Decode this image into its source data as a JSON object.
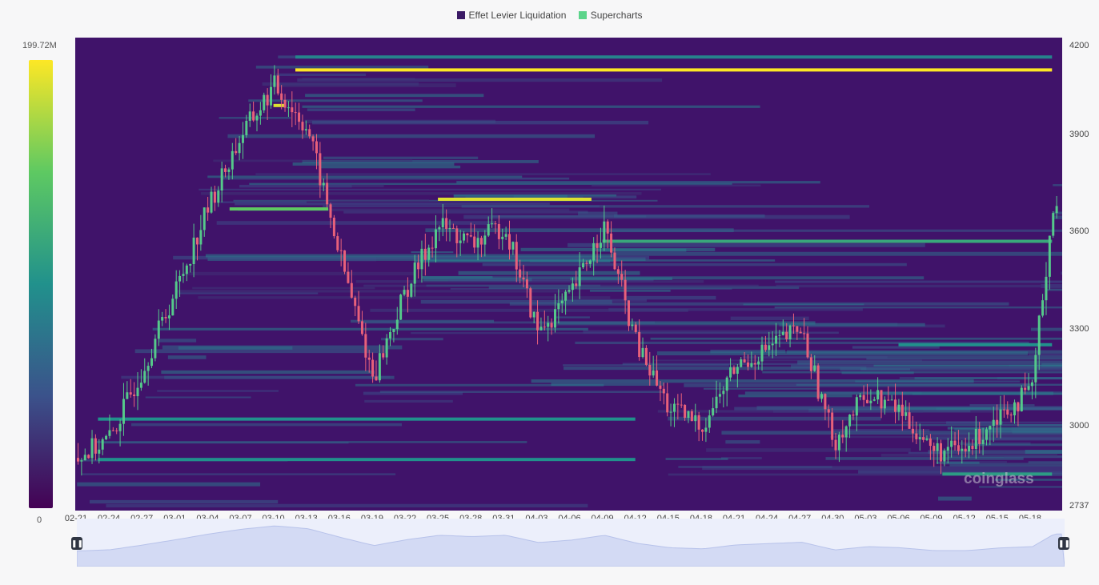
{
  "legend": {
    "items": [
      {
        "label": "Effet Levier Liquidation",
        "color": "#3b1a66"
      },
      {
        "label": "Supercharts",
        "color": "#5bd48a"
      }
    ]
  },
  "colorscale": {
    "max_label": "199.72M",
    "min_label": "0",
    "colors": [
      "#440154",
      "#3b528b",
      "#21918c",
      "#5ec962",
      "#fde725"
    ]
  },
  "watermark": "coinglass",
  "colors": {
    "up": "#55c98a",
    "down": "#e8607a",
    "background": "#40136a"
  },
  "chart_data": {
    "type": "heatmap",
    "title": "",
    "xlabel": "",
    "ylabel": "",
    "ylim": [
      2737,
      4200
    ],
    "y_ticks": [
      "4200",
      "3900",
      "3600",
      "3300",
      "3000",
      "2737"
    ],
    "x_ticks": [
      "02-21",
      "02-24",
      "02-27",
      "03-01",
      "03-04",
      "03-07",
      "03-10",
      "03-13",
      "03-16",
      "03-19",
      "03-22",
      "03-25",
      "03-28",
      "03-31",
      "04-03",
      "04-06",
      "04-09",
      "04-12",
      "04-15",
      "04-18",
      "04-21",
      "04-24",
      "04-27",
      "04-30",
      "05-03",
      "05-06",
      "05-09",
      "05-12",
      "05-15",
      "05-18"
    ],
    "price_path": [
      {
        "x": "02-21",
        "y": 2900
      },
      {
        "x": "02-24",
        "y": 2960
      },
      {
        "x": "02-27",
        "y": 3180
      },
      {
        "x": "03-01",
        "y": 3420
      },
      {
        "x": "03-04",
        "y": 3680
      },
      {
        "x": "03-07",
        "y": 3900
      },
      {
        "x": "03-10",
        "y": 4050
      },
      {
        "x": "03-13",
        "y": 3920
      },
      {
        "x": "03-16",
        "y": 3520
      },
      {
        "x": "03-19",
        "y": 3150
      },
      {
        "x": "03-22",
        "y": 3420
      },
      {
        "x": "03-25",
        "y": 3620
      },
      {
        "x": "03-28",
        "y": 3560
      },
      {
        "x": "03-31",
        "y": 3620
      },
      {
        "x": "04-03",
        "y": 3290
      },
      {
        "x": "04-06",
        "y": 3400
      },
      {
        "x": "04-09",
        "y": 3620
      },
      {
        "x": "04-12",
        "y": 3250
      },
      {
        "x": "04-15",
        "y": 3050
      },
      {
        "x": "04-18",
        "y": 3000
      },
      {
        "x": "04-21",
        "y": 3180
      },
      {
        "x": "04-24",
        "y": 3240
      },
      {
        "x": "04-27",
        "y": 3300
      },
      {
        "x": "04-30",
        "y": 2950
      },
      {
        "x": "05-03",
        "y": 3100
      },
      {
        "x": "05-06",
        "y": 3050
      },
      {
        "x": "05-09",
        "y": 2920
      },
      {
        "x": "05-12",
        "y": 2920
      },
      {
        "x": "05-15",
        "y": 3040
      },
      {
        "x": "05-18",
        "y": 3100
      },
      {
        "x": "05-20",
        "y": 3680
      }
    ],
    "liquidation_levels": [
      {
        "price": 4100,
        "start": "03-11",
        "end": "05-20",
        "intensity": 1.0
      },
      {
        "price": 3990,
        "start": "03-10",
        "end": "03-10",
        "intensity": 0.95
      },
      {
        "price": 3700,
        "start": "03-25",
        "end": "04-08",
        "intensity": 0.95
      },
      {
        "price": 3670,
        "start": "03-05",
        "end": "03-14",
        "intensity": 0.75
      },
      {
        "price": 3570,
        "start": "04-09",
        "end": "05-20",
        "intensity": 0.6
      },
      {
        "price": 4140,
        "start": "03-11",
        "end": "05-20",
        "intensity": 0.45
      },
      {
        "price": 3250,
        "start": "05-06",
        "end": "05-20",
        "intensity": 0.5
      },
      {
        "price": 3020,
        "start": "02-23",
        "end": "04-12",
        "intensity": 0.5
      },
      {
        "price": 2895,
        "start": "02-23",
        "end": "04-12",
        "intensity": 0.5
      },
      {
        "price": 2850,
        "start": "05-10",
        "end": "05-20",
        "intensity": 0.55
      }
    ]
  }
}
